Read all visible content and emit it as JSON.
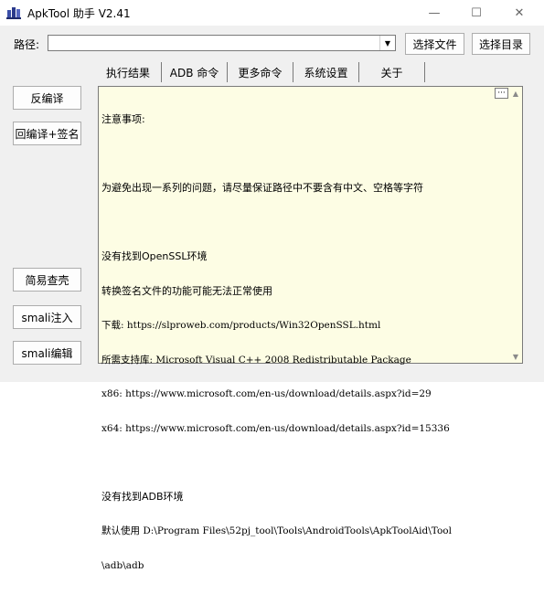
{
  "window": {
    "title": "ApkTool 助手 V2.41",
    "controls": {
      "minimize": "—",
      "maximize": "☐",
      "close": "✕"
    }
  },
  "path_bar": {
    "label": "路径:",
    "value": "",
    "dropdown_glyph": "▼",
    "select_file_label": "选择文件",
    "select_dir_label": "选择目录"
  },
  "tabs": [
    {
      "label": "执行结果",
      "active": true
    },
    {
      "label": "ADB 命令",
      "active": false
    },
    {
      "label": "更多命令",
      "active": false
    },
    {
      "label": "系统设置",
      "active": false
    },
    {
      "label": "关于",
      "active": false
    }
  ],
  "sidebar": {
    "decompile_label": "反编译",
    "recompile_sign_label": "回编译+签名",
    "shell_check_label": "简易查壳",
    "smali_inject_label": "smali注入",
    "smali_edit_label": "smali编辑"
  },
  "output": {
    "more_button": "···",
    "lines": [
      "注意事项:",
      "",
      "为避免出现一系列的问题，请尽量保证路径中不要含有中文、空格等字符",
      "",
      "没有找到OpenSSL环境",
      "转换签名文件的功能可能无法正常使用",
      "下载: https://slproweb.com/products/Win32OpenSSL.html",
      "所需支持库: Microsoft Visual C++ 2008 Redistributable Package",
      "x86: https://www.microsoft.com/en-us/download/details.aspx?id=29",
      "x64: https://www.microsoft.com/en-us/download/details.aspx?id=15336",
      "",
      "没有找到ADB环境",
      "默认使用 D:\\Program Files\\52pj_tool\\Tools\\AndroidTools\\ApkToolAid\\Tool",
      "\\adb\\adb"
    ]
  },
  "colors": {
    "window_bg": "#f0f0f0",
    "output_bg": "#fdfde4",
    "border": "#7a7a7a"
  }
}
